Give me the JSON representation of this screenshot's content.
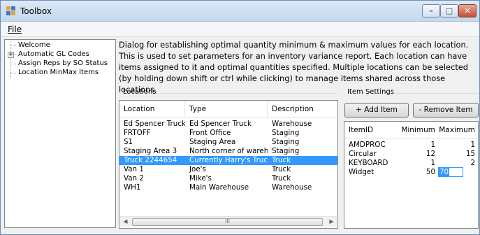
{
  "window": {
    "title": "Toolbox",
    "controls": {
      "minimize": "–",
      "maximize": "□",
      "close": "✕"
    }
  },
  "menu": {
    "file_label": "File"
  },
  "tree": {
    "items": [
      {
        "label": "Welcome",
        "expandable": false
      },
      {
        "label": "Automatic GL Codes",
        "expandable": true,
        "expander": "+"
      },
      {
        "label": "Assign Reps by SO Status",
        "expandable": false
      },
      {
        "label": "Location MinMax Items",
        "expandable": false
      }
    ]
  },
  "description": "Dialog for establishing optimal quantity minimum & maximum values for each location. This is used to set parameters for an inventory variance report. Each location can have items assigned to it and optimal quantities specified. Multiple locations can be selected (by holding down shift or ctrl while clicking) to manage items shared across those locations.",
  "locations": {
    "group_label": "Locations",
    "columns": [
      "Location",
      "Type",
      "Description"
    ],
    "rows": [
      {
        "location": "Ed Spencer Truck",
        "type": "Ed Spencer Truck",
        "description": "Warehouse",
        "selected": false
      },
      {
        "location": "FRTOFF",
        "type": "Front Office",
        "description": "Staging",
        "selected": false
      },
      {
        "location": "S1",
        "type": "Staging Area",
        "description": "Staging",
        "selected": false
      },
      {
        "location": "Staging Area 3",
        "type": "North corner of wareh...",
        "description": "Staging",
        "selected": false
      },
      {
        "location": "Truck 2244654",
        "type": "Currently Harry's Truck",
        "description": "Truck",
        "selected": true
      },
      {
        "location": "Van 1",
        "type": "Joe's",
        "description": "Truck",
        "selected": false
      },
      {
        "location": "Van 2",
        "type": "Mike's",
        "description": "Truck",
        "selected": false
      },
      {
        "location": "WH1",
        "type": "Main Warehouse",
        "description": "Warehouse",
        "selected": false
      }
    ],
    "scroll": {
      "left": "◀",
      "right": "▶",
      "thumb_grip": "III"
    }
  },
  "item_settings": {
    "group_label": "Item Settings",
    "add_button": "+ Add Item",
    "remove_button": "- Remove Item",
    "columns": [
      "ItemID",
      "Minimum",
      "Maximum"
    ],
    "rows": [
      {
        "item": "AMDPROC",
        "minimum": "1",
        "maximum": "1"
      },
      {
        "item": "Circular",
        "minimum": "12",
        "maximum": "15"
      },
      {
        "item": "KEYBOARD",
        "minimum": "1",
        "maximum": "2"
      },
      {
        "item": "Widget",
        "minimum": "50",
        "maximum": "70",
        "editing": true
      }
    ]
  },
  "colors": {
    "selection": "#3399ff",
    "title_bar": "#c4d8ee",
    "close_button": "#c74a32"
  }
}
